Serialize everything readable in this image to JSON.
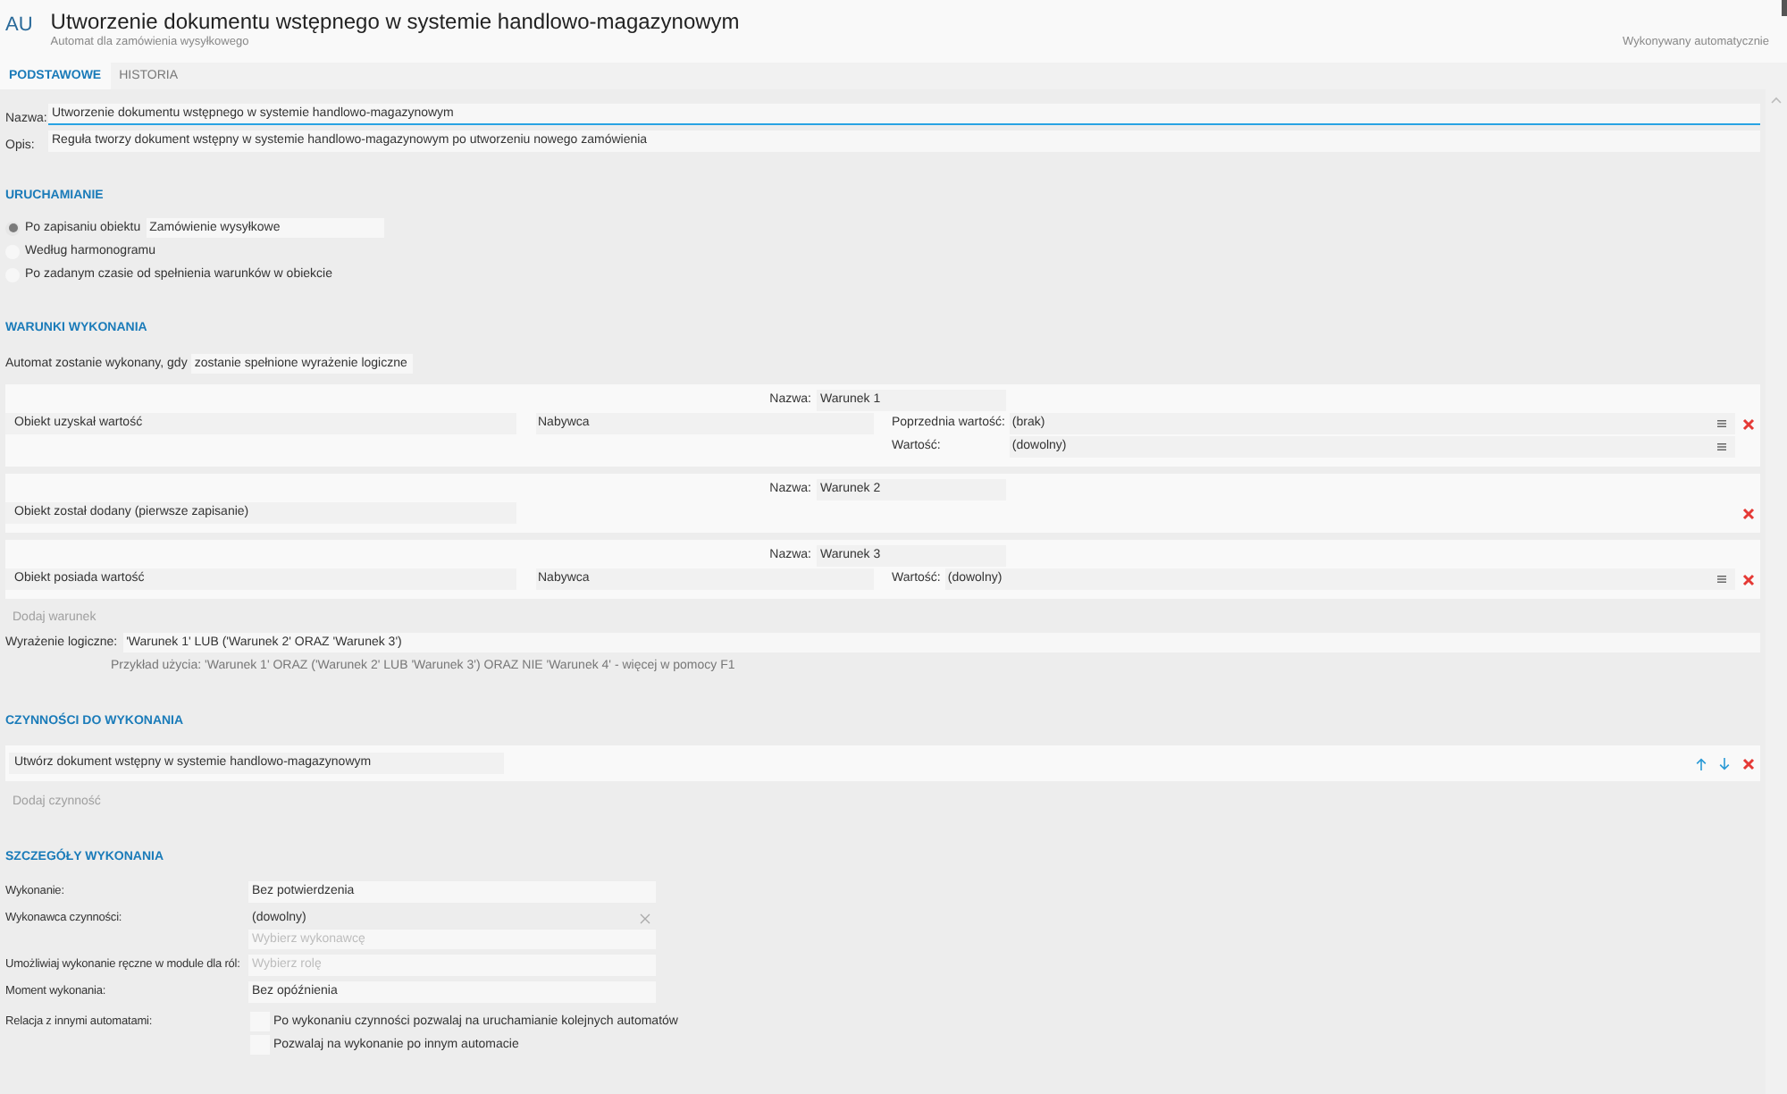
{
  "header": {
    "badge": "AU",
    "title": "Utworzenie dokumentu wstępnego w systemie handlowo-magazynowym",
    "subtitle": "Automat dla zamówienia wysyłkowego",
    "mode": "Wykonywany automatycznie"
  },
  "tabs": [
    {
      "label": "PODSTAWOWE",
      "selected": true
    },
    {
      "label": "HISTORIA",
      "selected": false
    }
  ],
  "fields": [
    {
      "label": "Nazwa:",
      "value": "Utworzenie dokumentu wstępnego w systemie handlowo-magazynowym",
      "focused": true
    },
    {
      "label": "Opis:",
      "value": "Reguła tworzy dokument wstępny w systemie handlowo-magazynowym po utworzeniu nowego zamówienia",
      "focused": false
    }
  ],
  "launch": {
    "heading": "URUCHAMIANIE",
    "options": [
      {
        "label": "Po zapisaniu obiektu",
        "selected": true,
        "value": "Zamówienie wysyłkowe"
      },
      {
        "label": "Według harmonogramu",
        "selected": false
      },
      {
        "label": "Po zadanym czasie od spełnienia warunków w obiekcie",
        "selected": false
      }
    ]
  },
  "conditions": {
    "heading": "WARUNKI WYKONANIA",
    "mode_label": "Automat zostanie wykonany, gdy",
    "mode_value": "zostanie spełnione wyrażenie logiczne",
    "items": [
      {
        "name_label": "Nazwa:",
        "name": "Warunek 1",
        "type": "Obiekt uzyskał wartość",
        "attribute": "Nabywca",
        "values": [
          {
            "label": "Poprzednia wartość:",
            "value": "(brak)"
          },
          {
            "label": "Wartość:",
            "value": "(dowolny)"
          }
        ]
      },
      {
        "name_label": "Nazwa:",
        "name": "Warunek 2",
        "type": "Obiekt został dodany (pierwsze zapisanie)"
      },
      {
        "name_label": "Nazwa:",
        "name": "Warunek 3",
        "type": "Obiekt posiada wartość",
        "attribute": "Nabywca",
        "values": [
          {
            "label": "Wartość:",
            "value": "(dowolny)"
          }
        ]
      }
    ],
    "add_label": "Dodaj warunek",
    "expression_label": "Wyrażenie logiczne:",
    "expression": "'Warunek 1' LUB ('Warunek 2' ORAZ 'Warunek 3')",
    "hint": "Przykład użycia: 'Warunek 1' ORAZ ('Warunek 2' LUB 'Warunek 3') ORAZ NIE 'Warunek 4' - więcej w pomocy F1"
  },
  "actions": {
    "heading": "CZYNNOŚCI DO WYKONANIA",
    "items": [
      {
        "name": "Utwórz dokument wstępny w systemie handlowo-magazynowym"
      }
    ],
    "add_label": "Dodaj czynność"
  },
  "details": {
    "heading": "SZCZEGÓŁY WYKONANIA",
    "rows": [
      {
        "kind": "field",
        "label": "Wykonanie:",
        "value": "Bez potwierdzenia"
      },
      {
        "kind": "picker",
        "label": "Wykonawca czynności:",
        "value": "(dowolny)",
        "placeholder": "Wybierz wykonawcę"
      },
      {
        "kind": "field",
        "label": "Umożliwiaj wykonanie ręczne w module dla ról:",
        "placeholder": "Wybierz rolę"
      },
      {
        "kind": "field",
        "label": "Moment wykonania:",
        "value": "Bez opóźnienia"
      },
      {
        "kind": "checks",
        "label": "Relacja z innymi automatami:",
        "options": [
          {
            "label": "Po wykonaniu czynności pozwalaj na uruchamianie kolejnych automatów",
            "checked": false
          },
          {
            "label": "Pozwalaj na wykonanie po innym automacie",
            "checked": false
          }
        ]
      }
    ]
  }
}
